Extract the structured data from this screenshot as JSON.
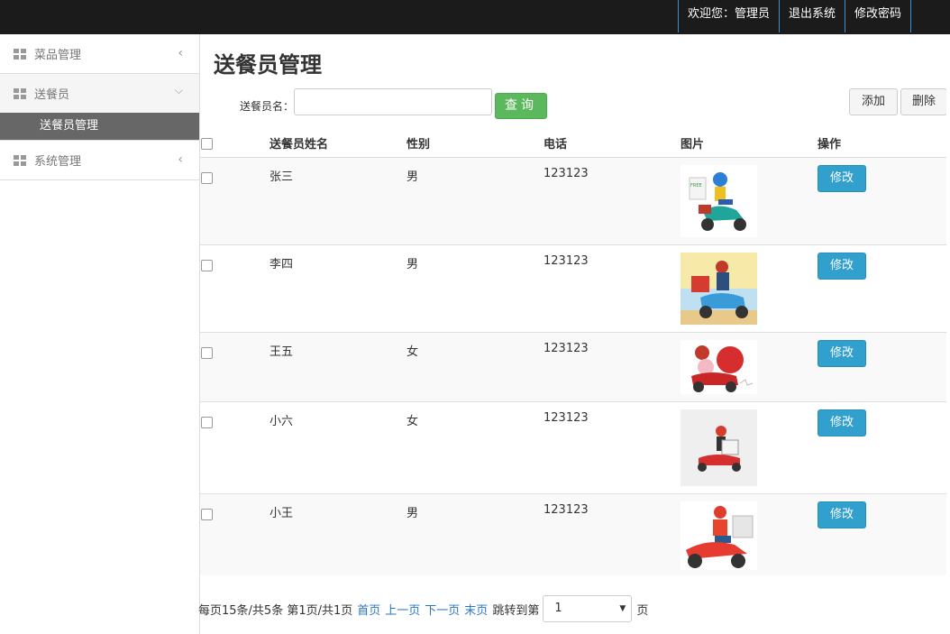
{
  "header": {
    "welcome": "欢迎您：管理员",
    "logout": "退出系统",
    "change_password": "修改密码"
  },
  "sidebar": {
    "groups": [
      {
        "label": "菜品管理",
        "icon": "grid-icon",
        "state": "collapsed"
      },
      {
        "label": "送餐员",
        "icon": "grid-icon",
        "state": "expanded",
        "items": [
          {
            "label": "送餐员管理",
            "active": true
          }
        ]
      },
      {
        "label": "系统管理",
        "icon": "grid-icon",
        "state": "collapsed"
      }
    ]
  },
  "main": {
    "title": "送餐员管理",
    "search": {
      "label": "送餐员名：",
      "value": "",
      "placeholder": ""
    },
    "query_button": "查询",
    "add_button": "添加",
    "delete_button": "删除",
    "table": {
      "headers": [
        "送餐员姓名",
        "性别",
        "电话",
        "图片",
        "操作"
      ],
      "rows": [
        {
          "name": "张三",
          "sex": "男",
          "tel": "123123",
          "image": "delivery-scooter-teal",
          "action": "修改"
        },
        {
          "name": "李四",
          "sex": "男",
          "tel": "123123",
          "image": "delivery-scooter-blue",
          "action": "修改"
        },
        {
          "name": "王五",
          "sex": "女",
          "tel": "123123",
          "image": "delivery-scooter-red-pig",
          "action": "修改"
        },
        {
          "name": "小六",
          "sex": "女",
          "tel": "123123",
          "image": "delivery-scooter-small",
          "action": "修改"
        },
        {
          "name": "小王",
          "sex": "男",
          "tel": "123123",
          "image": "delivery-scooter-red",
          "action": "修改"
        }
      ]
    },
    "pager": {
      "info": "每页15条/共5条 第1页/共1页",
      "first": "首页",
      "prev": "上一页",
      "next": "下一页",
      "last": "末页",
      "jump_label": "跳转到第",
      "page_value": "1",
      "unit": "页"
    }
  },
  "colors": {
    "topbar": "#1b1b1b",
    "accent_blue": "#31a0cc",
    "query_green": "#5cb85c",
    "link": "#2a76c6"
  }
}
